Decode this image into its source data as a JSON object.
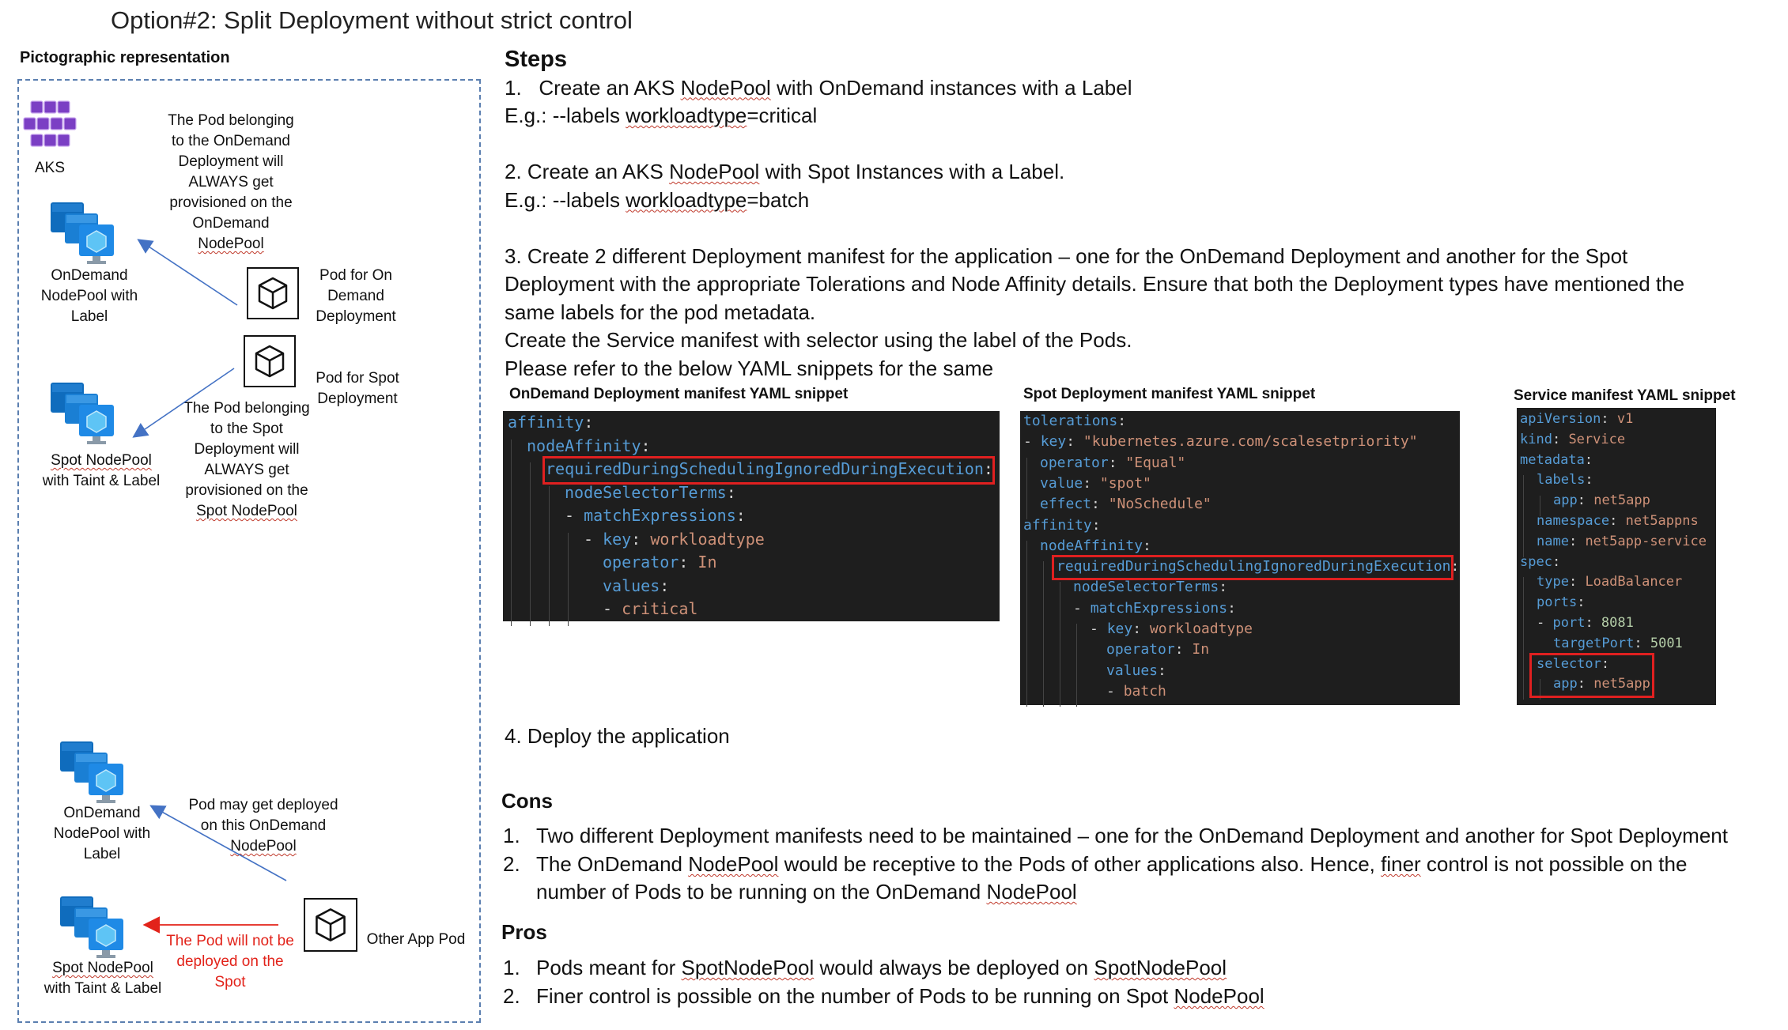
{
  "title": "Option#2: Split Deployment without strict control",
  "left_panel": {
    "label": "Pictographic representation",
    "aks_label": "AKS",
    "ondemand_nodepool_top": [
      "OnDemand",
      "NodePool with",
      "Label"
    ],
    "pod_belong_ondemand": [
      "The Pod belonging",
      "to the OnDemand",
      "Deployment will",
      "ALWAYS get",
      "provisioned on the",
      "OnDemand",
      "NodePool"
    ],
    "pod_for_ondemand": [
      "Pod for On",
      "Demand",
      "Deployment"
    ],
    "pod_for_spot": [
      "Pod for Spot",
      "Deployment"
    ],
    "spot_nodepool_top": [
      "Spot NodePool",
      "with Taint & Label"
    ],
    "pod_belong_spot": [
      "The Pod belonging",
      "to the Spot",
      "Deployment will",
      "ALWAYS get",
      "provisioned on the",
      "Spot NodePool"
    ],
    "ondemand_nodepool_bottom": [
      "OnDemand",
      "NodePool with",
      "Label"
    ],
    "pod_may_deploy": [
      "Pod may get deployed",
      "on this OnDemand",
      "NodePool"
    ],
    "spot_nodepool_bottom": [
      "Spot NodePool",
      "with Taint & Label"
    ],
    "pod_will_not": [
      "The Pod will not be",
      "deployed on the",
      "Spot"
    ],
    "other_app_pod": "Other App Pod",
    "colors": {
      "dash": "#5b7fb0",
      "arrow_blue": "#4472c4",
      "arrow_red": "#e2231a",
      "aks_purple": "#7b3fc4",
      "node_blue": "#0f6cbd"
    }
  },
  "steps": {
    "heading": "Steps",
    "s1_num": "1.",
    "s1_a": "Create an AKS ",
    "s1_b": "NodePool",
    "s1_c": " with OnDemand instances with a Label",
    "s1_eg_a": "E.g.: --labels ",
    "s1_eg_b": "workloadtype",
    "s1_eg_c": "=critical",
    "s2_a": "2. Create an AKS ",
    "s2_b": "NodePool",
    "s2_c": " with Spot Instances with a Label.",
    "s2_eg_a": "E.g.: --labels ",
    "s2_eg_b": "workloadtype",
    "s2_eg_c": "=batch",
    "s3_l1": "3. Create 2 different Deployment manifest for the application – one for the OnDemand Deployment and another for the Spot",
    "s3_l2": "Deployment with the appropriate Tolerations and Node Affinity details. Ensure that both the Deployment types have mentioned the",
    "s3_l3": "same labels for the pod metadata.",
    "s3_l4": "Create the Service manifest with selector using the label of the Pods.",
    "s3_l5": "Please refer to the below YAML snippets for the same",
    "s4": "4. Deploy the application"
  },
  "snippets": {
    "ondemand_title": "OnDemand Deployment manifest YAML snippet",
    "spot_title": "Spot Deployment manifest YAML snippet",
    "service_title": "Service manifest YAML snippet",
    "ondemand_lines": [
      {
        "indent": 0,
        "key": "affinity",
        "sep": ":",
        "val": ""
      },
      {
        "indent": 1,
        "key": "nodeAffinity",
        "sep": ":",
        "val": ""
      },
      {
        "indent": 2,
        "key": "requiredDuringSchedulingIgnoredDuringExecution",
        "sep": ":",
        "val": ""
      },
      {
        "indent": 3,
        "key": "nodeSelectorTerms",
        "sep": ":",
        "val": ""
      },
      {
        "indent": 3,
        "dash": true,
        "key": "matchExpressions",
        "sep": ":",
        "val": ""
      },
      {
        "indent": 4,
        "dash": true,
        "key": "key",
        "sep": ": ",
        "val": "workloadtype"
      },
      {
        "indent": 5,
        "key": "operator",
        "sep": ": ",
        "val": "In"
      },
      {
        "indent": 5,
        "key": "values",
        "sep": ":",
        "val": ""
      },
      {
        "indent": 5,
        "dash": true,
        "key": "",
        "sep": "",
        "val": "critical"
      }
    ],
    "spot_lines": [
      {
        "indent": 0,
        "key": "tolerations",
        "sep": ":",
        "val": ""
      },
      {
        "indent": 0,
        "dash": true,
        "key": "key",
        "sep": ": ",
        "val": "\"kubernetes.azure.com/scalesetpriority\""
      },
      {
        "indent": 1,
        "key": "operator",
        "sep": ": ",
        "val": "\"Equal\""
      },
      {
        "indent": 1,
        "key": "value",
        "sep": ": ",
        "val": "\"spot\""
      },
      {
        "indent": 1,
        "key": "effect",
        "sep": ": ",
        "val": "\"NoSchedule\""
      },
      {
        "indent": 0,
        "key": "affinity",
        "sep": ":",
        "val": ""
      },
      {
        "indent": 1,
        "key": "nodeAffinity",
        "sep": ":",
        "val": ""
      },
      {
        "indent": 2,
        "key": "requiredDuringSchedulingIgnoredDuringExecution",
        "sep": ":",
        "val": ""
      },
      {
        "indent": 3,
        "key": "nodeSelectorTerms",
        "sep": ":",
        "val": ""
      },
      {
        "indent": 3,
        "dash": true,
        "key": "matchExpressions",
        "sep": ":",
        "val": ""
      },
      {
        "indent": 4,
        "dash": true,
        "key": "key",
        "sep": ": ",
        "val": "workloadtype"
      },
      {
        "indent": 5,
        "key": "operator",
        "sep": ": ",
        "val": "In"
      },
      {
        "indent": 5,
        "key": "values",
        "sep": ":",
        "val": ""
      },
      {
        "indent": 5,
        "dash": true,
        "key": "",
        "sep": "",
        "val": "batch"
      }
    ],
    "service_lines": [
      {
        "indent": 0,
        "key": "apiVersion",
        "sep": ": ",
        "val": "v1"
      },
      {
        "indent": 0,
        "key": "kind",
        "sep": ": ",
        "val": "Service"
      },
      {
        "indent": 0,
        "key": "metadata",
        "sep": ":",
        "val": ""
      },
      {
        "indent": 1,
        "key": "labels",
        "sep": ":",
        "val": ""
      },
      {
        "indent": 2,
        "key": "app",
        "sep": ": ",
        "val": "net5app"
      },
      {
        "indent": 1,
        "key": "namespace",
        "sep": ": ",
        "val": "net5appns"
      },
      {
        "indent": 1,
        "key": "name",
        "sep": ": ",
        "val": "net5app-service"
      },
      {
        "indent": 0,
        "key": "spec",
        "sep": ":",
        "val": ""
      },
      {
        "indent": 1,
        "key": "type",
        "sep": ": ",
        "val": "LoadBalancer"
      },
      {
        "indent": 1,
        "key": "ports",
        "sep": ":",
        "val": ""
      },
      {
        "indent": 1,
        "dash": true,
        "key": "port",
        "sep": ": ",
        "val": "8081",
        "num": true
      },
      {
        "indent": 2,
        "key": "targetPort",
        "sep": ": ",
        "val": "5001",
        "num": true
      },
      {
        "indent": 1,
        "key": "selector",
        "sep": ":",
        "val": ""
      },
      {
        "indent": 2,
        "key": "app",
        "sep": ": ",
        "val": "net5app"
      }
    ]
  },
  "cons": {
    "heading": "Cons",
    "c1_num": "1.",
    "c1": "Two different Deployment manifests need to be maintained – one for the OnDemand Deployment and another for Spot Deployment",
    "c2_num": "2.",
    "c2_a": "The OnDemand ",
    "c2_b": "NodePool",
    "c2_c": " would be receptive to the Pods of other applications also. Hence, ",
    "c2_d": "finer",
    "c2_e": " control is not possible on the",
    "c2_l2_a": "number of Pods to be running on the OnDemand ",
    "c2_l2_b": "NodePool"
  },
  "pros": {
    "heading": "Pros",
    "p1_num": "1.",
    "p1_a": "Pods meant for ",
    "p1_b": "SpotNodePool",
    "p1_c": " would always be deployed on ",
    "p1_d": "SpotNodePool",
    "p2_num": "2.",
    "p2_a": "Finer control is possible on the number of Pods to be running on Spot ",
    "p2_b": "NodePool"
  }
}
